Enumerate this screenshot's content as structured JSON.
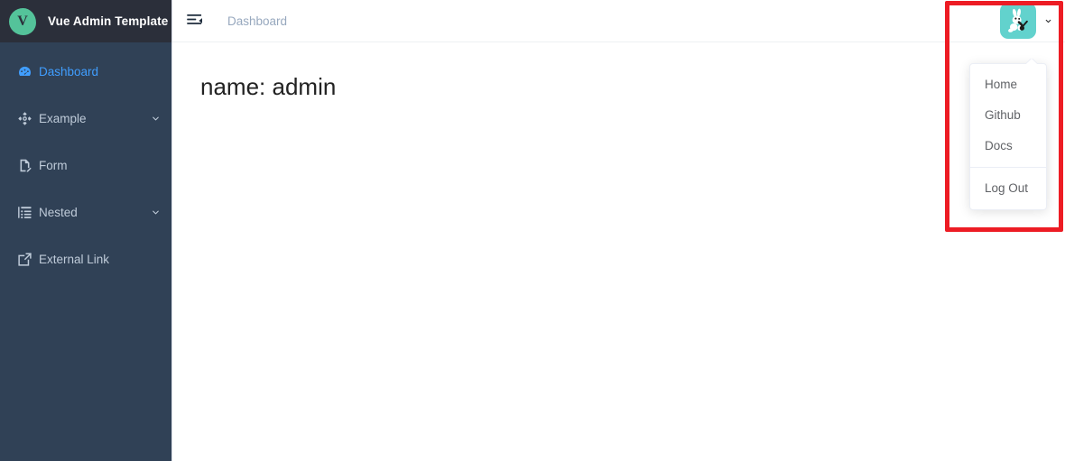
{
  "sidebar": {
    "brand": {
      "logo_letter": "V",
      "logo_color": "#54c39a",
      "title": "Vue Admin Template"
    },
    "items": [
      {
        "label": "Dashboard",
        "icon": "dashboard-gauge-icon",
        "active": true,
        "expandable": false
      },
      {
        "label": "Example",
        "icon": "component-icon",
        "active": false,
        "expandable": true
      },
      {
        "label": "Form",
        "icon": "form-document-icon",
        "active": false,
        "expandable": false
      },
      {
        "label": "Nested",
        "icon": "nested-list-icon",
        "active": false,
        "expandable": true
      },
      {
        "label": "External Link",
        "icon": "external-link-icon",
        "active": false,
        "expandable": false
      }
    ],
    "background_color": "#304156",
    "active_color": "#409eff"
  },
  "header": {
    "hamburger_icon": "hamburger-collapse-icon",
    "breadcrumb": "Dashboard",
    "avatar_icon": "rabbit-avatar-icon",
    "avatar_background": "#62d2cd",
    "caret_icon": "chevron-down-icon"
  },
  "dropdown": {
    "items": [
      {
        "label": "Home"
      },
      {
        "label": "Github"
      },
      {
        "label": "Docs"
      }
    ],
    "logout": {
      "label": "Log Out"
    }
  },
  "main": {
    "text": "name: admin"
  },
  "annotation": {
    "color": "#ed1c24"
  }
}
